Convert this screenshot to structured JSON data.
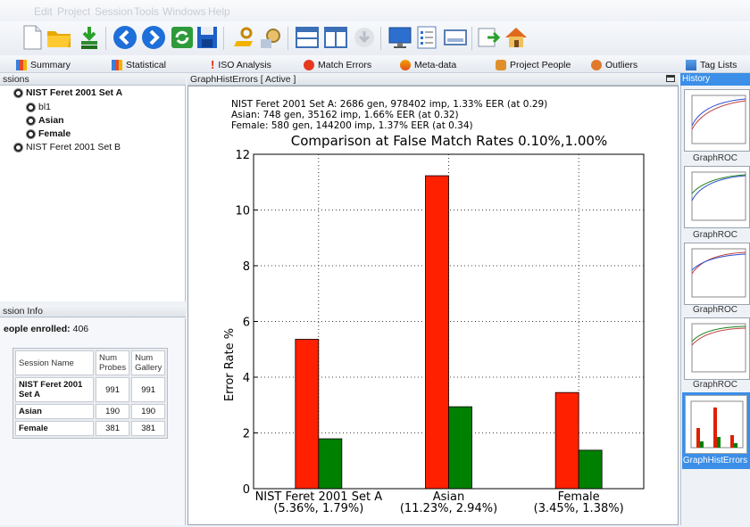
{
  "menu": [
    "Edit",
    "Project",
    "Session",
    "Tools",
    "Windows",
    "Help"
  ],
  "toolbar": {
    "buttons": [
      "new-document-icon",
      "open-folder-icon",
      "import-icon",
      "back-icon",
      "forward-icon",
      "refresh-icon",
      "save-icon",
      "key-icon",
      "settings-wizard-icon",
      "layout-rows-icon",
      "layout-columns-icon",
      "download-icon",
      "monitor-icon",
      "list-icon",
      "window-icon",
      "export-icon",
      "home-icon"
    ]
  },
  "tabs": [
    {
      "label": "Summary",
      "icon": "summary-chart-icon"
    },
    {
      "label": "Statistical",
      "icon": "statistical-chart-icon"
    },
    {
      "label": "ISO Analysis",
      "icon": "exclamation-icon"
    },
    {
      "label": "Match Errors",
      "icon": "error-circle-icon"
    },
    {
      "label": "Meta-data",
      "icon": "metadata-icon"
    },
    {
      "label": "Project People",
      "icon": "people-icon"
    },
    {
      "label": "Outliers",
      "icon": "outliers-icon"
    },
    {
      "label": "Tag Lists",
      "icon": "tag-list-icon"
    }
  ],
  "sessions_panel": {
    "title": "ssions",
    "items": [
      {
        "label": "NIST Feret 2001 Set A",
        "bold": true,
        "level": 0
      },
      {
        "label": "bl1",
        "bold": false,
        "level": 1
      },
      {
        "label": "Asian",
        "bold": true,
        "level": 1
      },
      {
        "label": "Female",
        "bold": true,
        "level": 1
      },
      {
        "label": "NIST Feret 2001 Set B",
        "bold": false,
        "level": 0
      }
    ]
  },
  "session_info": {
    "title": "ssion Info",
    "enrolled_label": "eople enrolled:",
    "enrolled_value": "406",
    "headers": [
      "Session Name",
      "Num Probes",
      "Num Gallery"
    ],
    "rows": [
      {
        "name": "NIST Feret 2001 Set A",
        "probes": "991",
        "gallery": "991"
      },
      {
        "name": "Asian",
        "probes": "190",
        "gallery": "190"
      },
      {
        "name": "Female",
        "probes": "381",
        "gallery": "381"
      }
    ]
  },
  "main_panel": {
    "title": "GraphHistErrors [ Active ]"
  },
  "history": {
    "title": "History",
    "items": [
      {
        "label": "GraphROC",
        "selected": false
      },
      {
        "label": "GraphROC",
        "selected": false
      },
      {
        "label": "GraphROC",
        "selected": false
      },
      {
        "label": "GraphROC",
        "selected": false
      },
      {
        "label": "GraphHistErrors",
        "selected": true
      }
    ]
  },
  "chart_data": {
    "type": "bar",
    "title": "Comparison at False Match Rates 0.10%,1.00%",
    "annotations": [
      "NIST Feret 2001 Set A: 2686 gen, 978402 imp, 1.33% EER (at 0.29)",
      "Asian: 748 gen, 35162 imp, 1.66% EER (at 0.32)",
      "Female: 580 gen, 144200 imp, 1.37% EER (at 0.34)"
    ],
    "ylabel": "Error Rate %",
    "xlabel": "",
    "ylim": [
      0,
      12
    ],
    "yticks": [
      0,
      2,
      4,
      6,
      8,
      10,
      12
    ],
    "categories": [
      "NIST Feret 2001 Set A",
      "Asian",
      "Female"
    ],
    "category_sublabels": [
      "(5.36%, 1.79%)",
      "(11.23%, 2.94%)",
      "(3.45%, 1.38%)"
    ],
    "series": [
      {
        "values": [
          5.36,
          11.23,
          3.45
        ],
        "color": "#ff2000"
      },
      {
        "values": [
          1.79,
          2.94,
          1.38
        ],
        "color": "#008000"
      }
    ],
    "grid": true
  },
  "colors": {
    "selection": "#3b8fe8",
    "error_bar": "#ff2000",
    "ok_bar": "#008000"
  }
}
